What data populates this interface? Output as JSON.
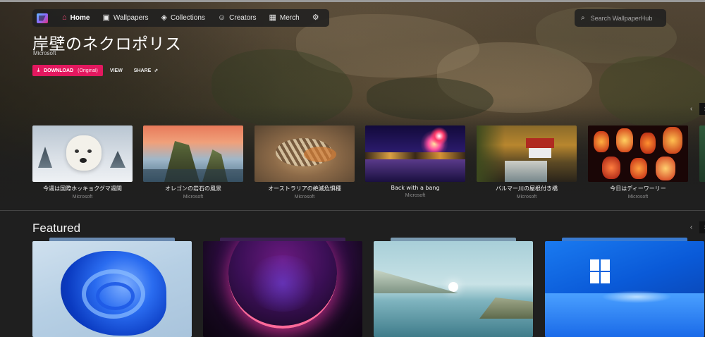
{
  "nav": {
    "items": [
      {
        "label": "Home",
        "icon": "home-icon",
        "active": true
      },
      {
        "label": "Wallpapers",
        "icon": "image-icon"
      },
      {
        "label": "Collections",
        "icon": "layers-icon"
      },
      {
        "label": "Creators",
        "icon": "users-icon"
      },
      {
        "label": "Merch",
        "icon": "shop-icon"
      },
      {
        "label": "",
        "icon": "gear-icon"
      }
    ]
  },
  "search": {
    "placeholder": "Search WallpaperHub"
  },
  "hero": {
    "title": "岸壁のネクロポリス",
    "author": "Microsoft",
    "download_label": "DOWNLOAD",
    "download_sub": "(Original)",
    "view_label": "VIEW",
    "share_label": "SHARE"
  },
  "thumbnails": [
    {
      "title": "今週は国際ホッキョクグマ週間",
      "author": "Microsoft"
    },
    {
      "title": "オレゴンの岩石の風景",
      "author": "Microsoft"
    },
    {
      "title": "オーストラリアの絶滅危惧種",
      "author": "Microsoft"
    },
    {
      "title": "Back with a bang",
      "author": "Microsoft"
    },
    {
      "title": "バルマー川の屋根付き橋",
      "author": "Microsoft"
    },
    {
      "title": "今日はディーワーリー",
      "author": "Microsoft"
    }
  ],
  "featured": {
    "title": "Featured"
  },
  "colors": {
    "accent": "#e3185f",
    "background": "#1f1f1f",
    "active_icon": "#ff4d7e"
  }
}
